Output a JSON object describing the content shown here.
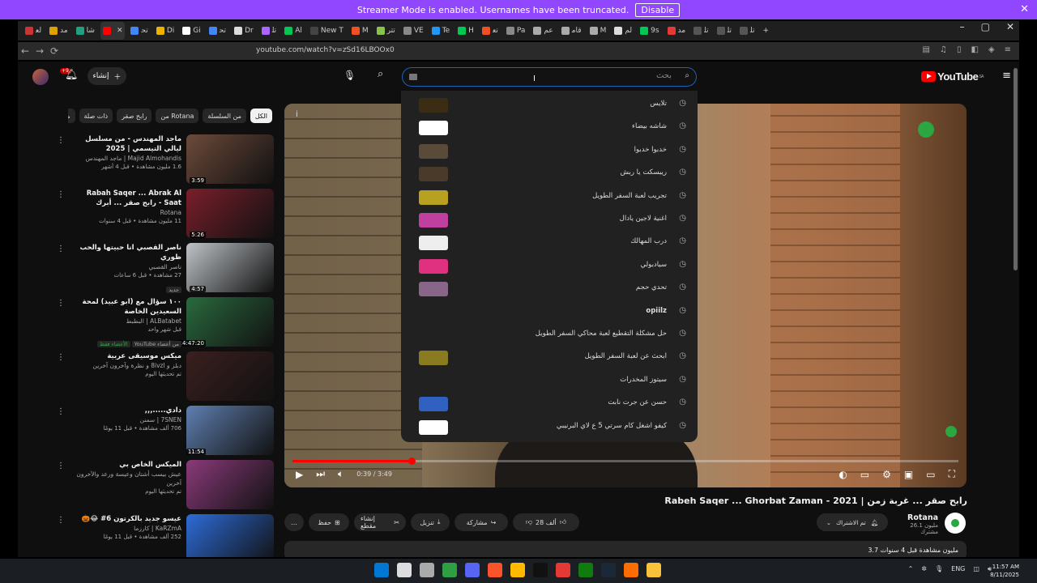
{
  "banner": {
    "text": "Streamer Mode is enabled. Usernames have been truncated.",
    "button": "Disable",
    "close": "✕"
  },
  "tabs": [
    {
      "label": "ﻟﻌ",
      "color": "#cc3333"
    },
    {
      "label": "ﻣﺪ",
      "color": "#e0a000"
    },
    {
      "label": "ﺷﺎ",
      "color": "#20a080"
    },
    {
      "label": "",
      "color": "#ff0000",
      "active": true
    },
    {
      "label": "ﺗﺤ",
      "color": "#4285f4"
    },
    {
      "label": "Di",
      "color": "#e8b400"
    },
    {
      "label": "Gi",
      "color": "#ffffff"
    },
    {
      "label": "ﺗﺤ",
      "color": "#4285f4"
    },
    {
      "label": "Dr",
      "color": "#dddddd"
    },
    {
      "label": "ﺗﻠ",
      "color": "#aa66ff"
    },
    {
      "label": "Al",
      "color": "#00c853"
    },
    {
      "label": "New T",
      "color": "#444444"
    },
    {
      "label": "M",
      "color": "#f25022"
    },
    {
      "label": "ﺗﺘﺮ",
      "color": "#8bc34a"
    },
    {
      "label": "VE",
      "color": "#888888"
    },
    {
      "label": "Te",
      "color": "#2196f3"
    },
    {
      "label": "H",
      "color": "#00c853"
    },
    {
      "label": "ﺗﻌ",
      "color": "#f25022"
    },
    {
      "label": "Pa",
      "color": "#888888"
    },
    {
      "label": "ﻋﻢ",
      "color": "#aaaaaa"
    },
    {
      "label": "ﻗﺎﻣ",
      "color": "#aaaaaa"
    },
    {
      "label": "M",
      "color": "#aaaaaa"
    },
    {
      "label": "ﻟﻢ",
      "color": "#dddddd"
    },
    {
      "label": "9s",
      "color": "#00c853"
    },
    {
      "label": "ﻣﺪ",
      "color": "#e53935"
    },
    {
      "label": "ﺗﻠ",
      "color": "#555555"
    },
    {
      "label": "ﺗﻠ",
      "color": "#555555"
    },
    {
      "label": "ﺗﻠ",
      "color": "#555555"
    }
  ],
  "tab_new": "+",
  "window": {
    "minimize": "–",
    "maximize": "▢",
    "close": "✕"
  },
  "address": {
    "url": "youtube.com/watch?v=zSd16LBOOx0",
    "back": "←",
    "forward": "→",
    "reload": "⟳"
  },
  "header": {
    "create_label": "إنشاء",
    "notif_count": "+9",
    "search_placeholder": "بحث",
    "logo_text": "YouTube",
    "logo_region": "SA"
  },
  "chips": [
    {
      "label": "الكل",
      "active": true
    },
    {
      "label": "من السلسلة"
    },
    {
      "label": "من Rotana"
    },
    {
      "label": "رابح صقر"
    },
    {
      "label": "ذات صلة"
    },
    {
      "label": "محتوى"
    }
  ],
  "recommendations": [
    {
      "title": "ماجد المهندس - من مسلسل ليالي التيسمي | 2025",
      "channel": "Majid Almohandis | ماجد المهندس",
      "meta": "1.6 مليون مشاهدة • قبل 4 أشهر",
      "duration": "3:59",
      "thumb": "#6d4a3a"
    },
    {
      "title": "Rabah Saqer ... Abrak Al Saat - رابح صقر ... أبرك الساعات | 2021",
      "channel": "Rotana",
      "meta": "11 مليون مشاهدة • قبل 4 سنوات",
      "duration": "5:26",
      "thumb": "#7a1f2b"
    },
    {
      "title": "ناصر القصبي انا حبيتها والحب ظوري",
      "channel": "ناصر القصبي",
      "meta": "27 مشاهدة • قبل 6 ساعات",
      "duration": "4:57",
      "badge": "جديد",
      "thumb": "#bfc4c8"
    },
    {
      "title": "١٠٠ سؤال مع (ابو عبيد) لمحة السعيدين الخاصة",
      "channel": "ALBatabet | البطبط",
      "meta": "قبل شهر واحد",
      "duration": "14:47:20",
      "badge": "من أعضاء YouTube",
      "badge2": "الأعضاء فقط",
      "thumb": "#2a6a3e"
    },
    {
      "title": "ميكس موسيقى عربية",
      "channel": "دبلز و 8ivzl و نظرة وآخرون آخرين",
      "meta": "تم تحديثها اليوم",
      "duration": "",
      "thumb": "#3b1f1f"
    },
    {
      "title": "دادي.....,,,",
      "channel": "7SNEN | سمنن",
      "meta": "706 ألف مشاهدة • قبل 11 يومًا",
      "duration": "11:54",
      "thumb": "#5f7fb0"
    },
    {
      "title": "الميكس الخاص بي",
      "channel": "عيش بيسب أشتان وعيسة ورعد والآخرون آخرين",
      "meta": "تم تحديثها اليوم",
      "duration": "",
      "thumb": "#8a3a7a"
    },
    {
      "title": "عيسو جديد بالكرتون 6# 😂🎃",
      "channel": "KaRZmA | كارزما",
      "meta": "252 ألف مشاهدة • قبل 11 يومًا",
      "duration": "",
      "thumb": "#2e6cd8"
    }
  ],
  "suggestions": [
    {
      "label": "تلايس",
      "thumb": "#3a2d14"
    },
    {
      "label": "شاشه بيضاء",
      "thumb": "#ffffff"
    },
    {
      "label": "خدبوا خدبوا",
      "thumb": "#5a4a3a"
    },
    {
      "label": "ريبسكت يا ربش",
      "thumb": "#4a3a2a"
    },
    {
      "label": "تجريب لعبة السفر الطويل",
      "thumb": "#b8a020"
    },
    {
      "label": "اغنية لاجين يادال",
      "thumb": "#c040a0"
    },
    {
      "label": "درب المهالك",
      "thumb": "#eeeeee"
    },
    {
      "label": "سيادبولي",
      "thumb": "#e03080"
    },
    {
      "label": "تحدي حجم",
      "thumb": "#886688"
    },
    {
      "label": "opiilz",
      "thumb": "",
      "bold": true
    },
    {
      "label": "حل مشكلة التقطيع لعبة محاكي السفر الطويل",
      "thumb": ""
    },
    {
      "label": "ابحث عن لعبة السفر الطويل",
      "thumb": "#8a7a20"
    },
    {
      "label": "سيتوز المخدرات",
      "thumb": ""
    },
    {
      "label": "حسن عن جرت نابت",
      "thumb": "#3060c0"
    },
    {
      "label": "كيفو اشغل كام سرتي 5 ع لاي البرنيبي",
      "thumb": "#ffffff"
    }
  ],
  "player": {
    "time": "0:39 / 3:49",
    "progress": 0.179,
    "info_icon": "i"
  },
  "video": {
    "title": "Rabeh Saqer ... Ghorbat Zaman - 2021 | رابح صقر ... غربة زمن",
    "channel": "Rotana",
    "subs": "26.1 مليون مشترك",
    "subscribed_label": "تم الاشتراك",
    "meta": "3.7 مليون مشاهدة قبل 4 سنوات"
  },
  "actions": {
    "like": "28 ألف",
    "share": "مشاركة",
    "download": "تنزيل",
    "clip": "إنشاء مقطع",
    "save": "حفظ",
    "more": "…"
  },
  "taskbar": {
    "icons": [
      "#0078d4",
      "#dddddd",
      "#aaaaaa",
      "#2ea043",
      "#5865f2",
      "#fb542b",
      "#ffb900",
      "#111111",
      "#e53935",
      "#107c10",
      "#1b2838",
      "#ff6d00",
      "#f8c33a"
    ],
    "lang": "ENG",
    "time": "11:57 AM",
    "date": "8/11/2025"
  }
}
